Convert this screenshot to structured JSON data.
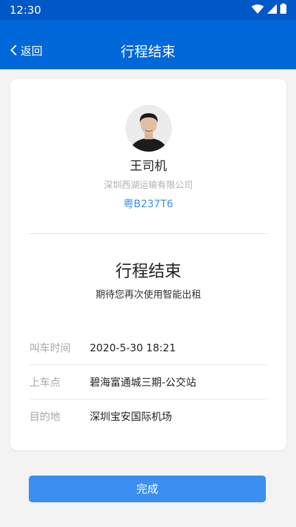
{
  "status_bar": {
    "time": "12:30",
    "icons": [
      "wifi-icon",
      "cellular-signal-icon",
      "battery-icon"
    ]
  },
  "header": {
    "back_label": "返回",
    "title": "行程结束"
  },
  "driver": {
    "avatar": "avatar-photo",
    "name": "王司机",
    "company": "深圳西湖运输有限公司",
    "plate": "粤B237T6"
  },
  "trip": {
    "status": "行程结束",
    "subtitle": "期待您再次使用智能出租",
    "details": [
      {
        "label": "叫车时间",
        "value": "2020-5-30 18:21"
      },
      {
        "label": "上车点",
        "value": "碧海富通城三期-公交站"
      },
      {
        "label": "目的地",
        "value": "深圳宝安国际机场"
      }
    ]
  },
  "actions": {
    "done_label": "完成"
  },
  "colors": {
    "status_bar": "#0058c7",
    "app_bar": "#0068d9",
    "accent": "#3a8ff0",
    "background": "#f3f3f3"
  }
}
